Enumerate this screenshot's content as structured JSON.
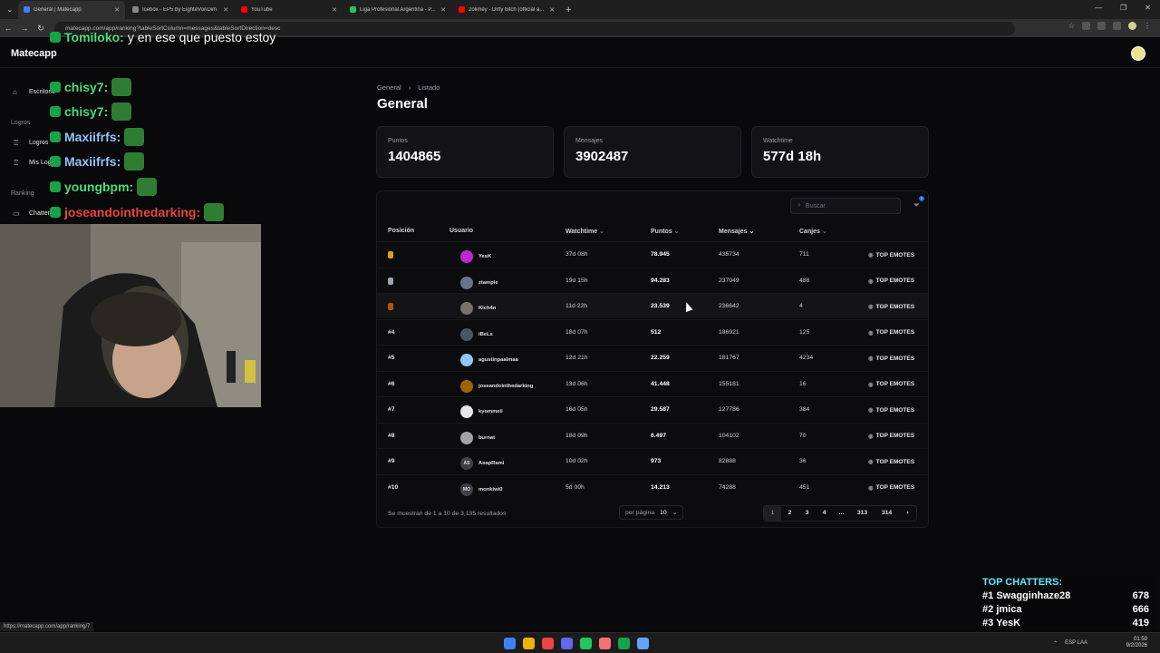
{
  "browser": {
    "tabs": [
      {
        "title": "General | Matecapp",
        "color": "#3b82f6",
        "active": true
      },
      {
        "title": "Icebox - EP5 by EighteVonDim",
        "color": "#888888"
      },
      {
        "title": "YouTube",
        "color": "#ff0000"
      },
      {
        "title": "Liga Profesional Argentina - P...",
        "color": "#22c55e"
      },
      {
        "title": "2olimey - Dirty bitch (official a...",
        "color": "#ff0000"
      }
    ],
    "url": "matecapp.com/app/ranking?tableSortColumn=messages&tableSortDirection=desc",
    "status_url": "https://matecapp.com/app/ranking/7",
    "new_tab": "+",
    "controls": [
      "—",
      "❐",
      "✕"
    ]
  },
  "app": {
    "brand": "Matecapp",
    "sidebar": {
      "items": [
        {
          "label": "Escritorio",
          "icon": "home-icon",
          "glyph": "⌂"
        },
        {
          "label": "Logros",
          "icon": "trophy-icon",
          "glyph": "♖"
        },
        {
          "label": "Mis Logros",
          "icon": "trophy-icon",
          "glyph": "♖"
        },
        {
          "label": "Chatters",
          "icon": "chat-icon",
          "glyph": "▭"
        }
      ],
      "sections": [
        "Logros",
        "Ranking"
      ]
    },
    "breadcrumb": [
      "General",
      "Listado"
    ],
    "title": "General",
    "stats": [
      {
        "label": "Puntos",
        "value": "1404865"
      },
      {
        "label": "Mensajes",
        "value": "3902487"
      },
      {
        "label": "Watchtime",
        "value": "577d 18h"
      }
    ],
    "search_placeholder": "Buscar",
    "filter_count": "0",
    "columns": [
      "Posición",
      "Usuario",
      "Watchtime",
      "Puntos",
      "Mensajes",
      "Canjes"
    ],
    "rows": [
      {
        "pos": "",
        "medal": "#d4a017",
        "user": "YesK",
        "avatar": "#c026d3",
        "watchtime": "37d 08h",
        "puntos": "78.945",
        "mensajes": "435734",
        "canjes": "711",
        "emotes": "TOP EMOTES"
      },
      {
        "pos": "",
        "medal": "#9ca3af",
        "user": "ztample",
        "avatar": "#64748b",
        "watchtime": "19d 15h",
        "puntos": "94.283",
        "mensajes": "237049",
        "canjes": "488",
        "emotes": "TOP EMOTES"
      },
      {
        "pos": "",
        "medal": "#b45309",
        "user": "Kich4n",
        "avatar": "#78716c",
        "watchtime": "11d 22h",
        "puntos": "23.539",
        "mensajes": "236642",
        "canjes": "4",
        "emotes": "TOP EMOTES"
      },
      {
        "pos": "#4",
        "user": "iBeLs",
        "avatar": "#4b5563",
        "watchtime": "18d 07h",
        "puntos": "512",
        "mensajes": "186921",
        "canjes": "125",
        "emotes": "TOP EMOTES"
      },
      {
        "pos": "#5",
        "user": "agustinpaalmaa",
        "avatar": "#93c5fd",
        "watchtime": "12d 21h",
        "puntos": "22.259",
        "mensajes": "181767",
        "canjes": "4234",
        "emotes": "TOP EMOTES"
      },
      {
        "pos": "#6",
        "user": "joseandointhedarking",
        "avatar": "#a16207",
        "watchtime": "13d 06h",
        "puntos": "41.448",
        "mensajes": "155181",
        "canjes": "16",
        "emotes": "TOP EMOTES"
      },
      {
        "pos": "#7",
        "user": "kyommeii",
        "avatar": "#e5e7eb",
        "watchtime": "16d 05h",
        "puntos": "29.587",
        "mensajes": "127786",
        "canjes": "384",
        "emotes": "TOP EMOTES"
      },
      {
        "pos": "#8",
        "user": "burnat",
        "avatar": "#a3a3a3",
        "watchtime": "18d 09h",
        "puntos": "6.497",
        "mensajes": "104102",
        "canjes": "70",
        "emotes": "TOP EMOTES"
      },
      {
        "pos": "#9",
        "user": "AsapRami",
        "avatar": "#3f3f46",
        "initials": "AS",
        "watchtime": "10d 02h",
        "puntos": "973",
        "mensajes": "82888",
        "canjes": "36",
        "emotes": "TOP EMOTES"
      },
      {
        "pos": "#10",
        "user": "monkiwi0",
        "avatar": "#3f3f46",
        "initials": "MO",
        "watchtime": "5d 00h",
        "puntos": "14.213",
        "mensajes": "74288",
        "canjes": "451",
        "emotes": "TOP EMOTES"
      }
    ],
    "results_text": "Se muestran de 1 a 10 de 3,135 resultados",
    "per_page_label": "por página",
    "per_page_value": "10",
    "pages": [
      "1",
      "2",
      "3",
      "4",
      "...",
      "313",
      "314",
      "›"
    ]
  },
  "stream": {
    "chat": [
      {
        "name": "Tomiloko:",
        "text": "y en ese que puesto estoy",
        "color": "#4ade80"
      },
      {
        "name": "chisy7:",
        "text": "",
        "color": "#4ade80"
      },
      {
        "name": "chisy7:",
        "text": "",
        "color": "#4ade80"
      },
      {
        "name": "Maxiifrfs:",
        "text": "",
        "color": "#93c5fd"
      },
      {
        "name": "Maxiifrfs:",
        "text": "",
        "color": "#93c5fd"
      },
      {
        "name": "youngbpm:",
        "text": "",
        "color": "#4ade80"
      },
      {
        "name": "joseandointhedarking:",
        "text": "",
        "color": "#ef4444"
      }
    ],
    "top_chatters_title": "TOP CHATTERS:",
    "top_chatters": [
      {
        "rank": "#1",
        "name": "Swagginhaze28",
        "count": "678"
      },
      {
        "rank": "#2",
        "name": "jmica",
        "count": "666"
      },
      {
        "rank": "#3",
        "name": "YesK",
        "count": "419"
      }
    ]
  },
  "taskbar": {
    "icons": [
      "#3b82f6",
      "#eab308",
      "#ef4444",
      "#6366f1",
      "#22c55e",
      "#f87171",
      "#16a34a",
      "#60a5fa"
    ],
    "lang": "ESP LAA",
    "time": "01:59",
    "date": "9/2/2026"
  }
}
